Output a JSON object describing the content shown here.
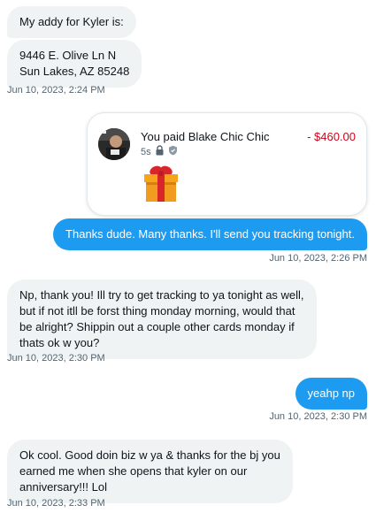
{
  "messages": {
    "m1": "My addy for Kyler is:",
    "m2_line1": "9446 E. Olive Ln N",
    "m2_line2": "Sun Lakes, AZ 85248",
    "ts1": "Jun 10, 2023, 2:24 PM",
    "payment": {
      "prefix": "You paid",
      "recipient": "Blake Chic Chic",
      "amount": "- $460.00",
      "age": "5s"
    },
    "m3": "Thanks dude. Many thanks. I'll send you tracking tonight.",
    "ts2": "Jun 10, 2023, 2:26 PM",
    "m4_line1": "Np, thank you! Ill try to get tracking to ya tonight as well,",
    "m4_line2": "but if not itll be forst thing monday morning, would that",
    "m4_line3": "be alright? Shippin out a couple other cards monday if",
    "m4_line4": "thats ok w you?",
    "ts3": "Jun 10, 2023, 2:30 PM",
    "m5": "yeahp np",
    "ts4": "Jun 10, 2023, 2:30 PM",
    "m6_line1": "Ok cool. Good doin biz w ya & thanks for the bj you",
    "m6_line2": "earned me when she opens that kyler on our",
    "m6_line3": "anniversary!!! Lol",
    "ts5": "Jun 10, 2023, 2:33 PM"
  },
  "colors": {
    "outgoing_bubble": "#1d9bf0",
    "incoming_bubble": "#eff3f4",
    "amount_red": "#d0021b",
    "timestamp_gray": "#536471"
  },
  "icons": [
    "lock-icon",
    "shield-icon",
    "gift-icon",
    "avatar"
  ]
}
